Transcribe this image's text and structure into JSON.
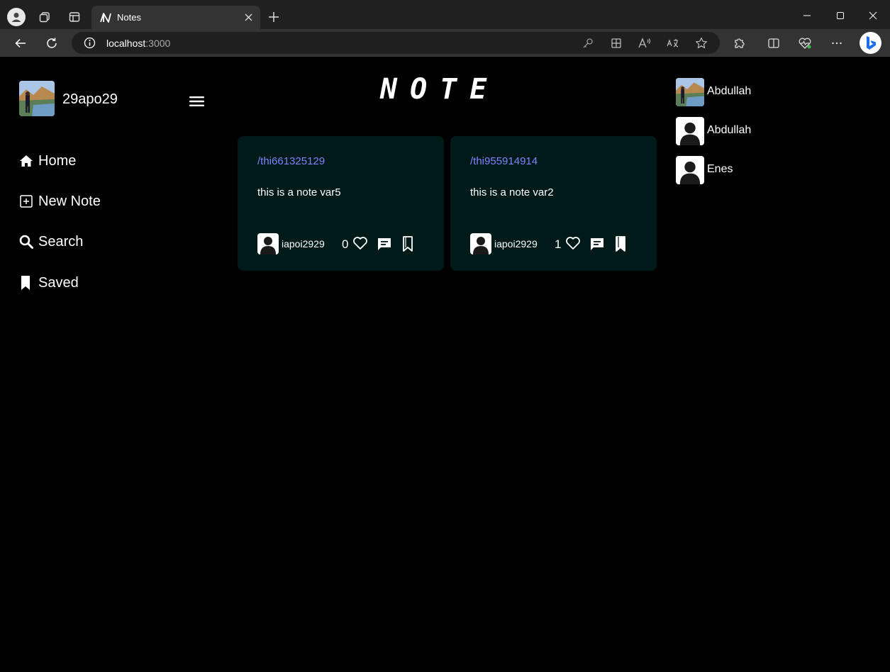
{
  "browser": {
    "tab_title": "Notes",
    "url_host": "localhost",
    "url_port": ":3000"
  },
  "app": {
    "logo": "NOTE",
    "username": "29apo29",
    "nav": [
      {
        "label": "Home",
        "icon": "home-icon"
      },
      {
        "label": "New Note",
        "icon": "plus-square-icon"
      },
      {
        "label": "Search",
        "icon": "search-icon"
      },
      {
        "label": "Saved",
        "icon": "bookmark-icon"
      }
    ],
    "notes": [
      {
        "path": "/thi661325129",
        "text": "this is a note var5",
        "author": "iapoi2929",
        "likes": "0",
        "saved": false
      },
      {
        "path": "/thi955914914",
        "text": "this is a note var2",
        "author": "iapoi2929",
        "likes": "1",
        "saved": true
      }
    ],
    "friends": [
      {
        "name": "Abdullah",
        "avatar": "photo"
      },
      {
        "name": "Abdullah",
        "avatar": "default"
      },
      {
        "name": "Enes",
        "avatar": "default"
      }
    ]
  },
  "colors": {
    "card_bg": "#001a1a",
    "link": "#7b86ff",
    "page_bg": "#000000"
  }
}
